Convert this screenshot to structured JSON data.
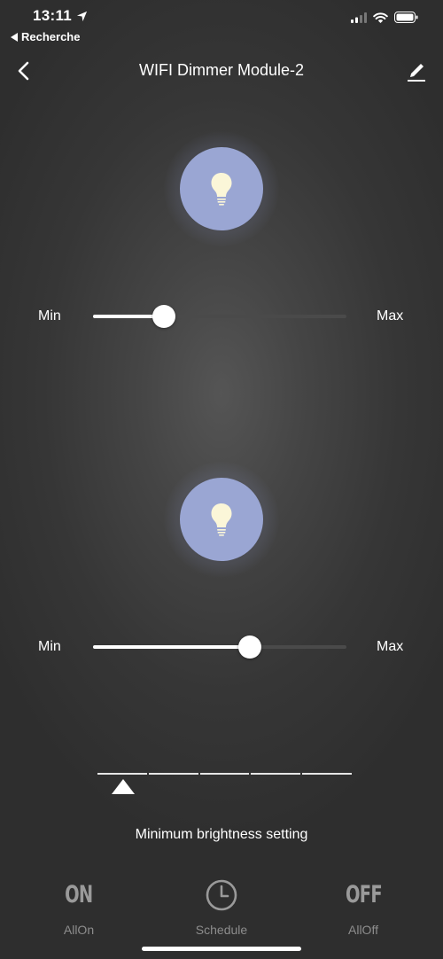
{
  "status_bar": {
    "time": "13:11",
    "back_app": "Recherche",
    "icons": [
      "location-arrow-icon",
      "signal-icon",
      "wifi-icon",
      "battery-icon"
    ]
  },
  "nav": {
    "title": "WIFI Dimmer Module-2",
    "back_icon": "chevron-left-icon",
    "edit_icon": "pencil-icon"
  },
  "channels": [
    {
      "icon": "lightbulb-icon",
      "min_label": "Min",
      "max_label": "Max",
      "level": 0.28
    },
    {
      "icon": "lightbulb-icon",
      "min_label": "Min",
      "max_label": "Max",
      "level": 0.62
    }
  ],
  "brightness_selector": {
    "segments": 5,
    "selected": 1
  },
  "min_brightness_label": "Minimum brightness setting",
  "bottom_bar": {
    "all_on": {
      "symbol": "ON",
      "label": "AllOn"
    },
    "schedule": {
      "icon": "clock-icon",
      "label": "Schedule"
    },
    "all_off": {
      "symbol": "OFF",
      "label": "AllOff"
    }
  },
  "colors": {
    "bulb": "#9aa6d3",
    "accent": "#ffffff",
    "muted": "#9a9a9a"
  }
}
